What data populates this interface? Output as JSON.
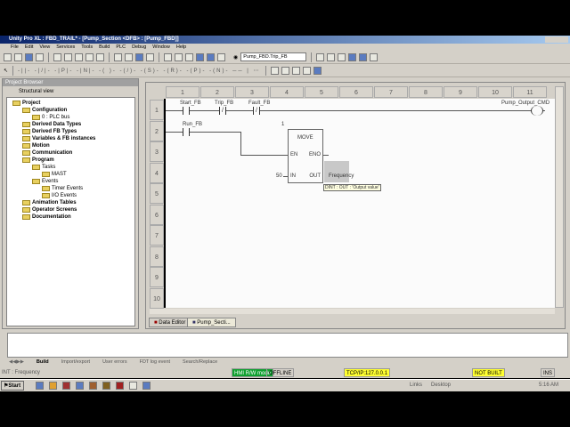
{
  "window": {
    "title": "Unity Pro XL : FBD_TRAIL* - [Pump_Section <DFB> : [Pump_FBD]]"
  },
  "menu": [
    "File",
    "Edit",
    "View",
    "Services",
    "Tools",
    "Build",
    "PLC",
    "Debug",
    "Window",
    "Help"
  ],
  "toolbar": {
    "search_value": "Pump_FBD.Trip_FB"
  },
  "browser": {
    "title": "Project Browser",
    "view": "Structural view",
    "items": [
      {
        "label": "Project",
        "bold": true,
        "indent": 0
      },
      {
        "label": "Configuration",
        "bold": true,
        "indent": 1
      },
      {
        "label": "0 : PLC bus",
        "bold": false,
        "indent": 2
      },
      {
        "label": "Derived Data Types",
        "bold": true,
        "indent": 1
      },
      {
        "label": "Derived FB Types",
        "bold": true,
        "indent": 1
      },
      {
        "label": "Variables & FB instances",
        "bold": true,
        "indent": 1
      },
      {
        "label": "Motion",
        "bold": true,
        "indent": 1
      },
      {
        "label": "Communication",
        "bold": true,
        "indent": 1
      },
      {
        "label": "Program",
        "bold": true,
        "indent": 1
      },
      {
        "label": "Tasks",
        "bold": false,
        "indent": 2
      },
      {
        "label": "MAST",
        "bold": false,
        "indent": 3
      },
      {
        "label": "Events",
        "bold": false,
        "indent": 2
      },
      {
        "label": "Timer Events",
        "bold": false,
        "indent": 3
      },
      {
        "label": "I/O Events",
        "bold": false,
        "indent": 3
      },
      {
        "label": "Animation Tables",
        "bold": true,
        "indent": 1
      },
      {
        "label": "Operator Screens",
        "bold": true,
        "indent": 1
      },
      {
        "label": "Documentation",
        "bold": true,
        "indent": 1
      }
    ]
  },
  "editor": {
    "columns": [
      "1",
      "2",
      "3",
      "4",
      "5",
      "6",
      "7",
      "8",
      "9",
      "10",
      "11"
    ],
    "rows": [
      "1",
      "2",
      "3",
      "4",
      "5",
      "6",
      "7",
      "8",
      "9",
      "10"
    ],
    "contacts": {
      "start": "Start_FB",
      "trip": "Trip_FB",
      "fault": "Fault_FB",
      "run": "Run_FB"
    },
    "coil": "Pump_Output_CMD",
    "block": {
      "number": "1",
      "name": "MOVE",
      "en": "EN",
      "eno": "ENO",
      "in": "IN",
      "out": "OUT",
      "in_value": "50",
      "out_var": "Frequency"
    },
    "tooltip": "DINT : OUT : 'Output value'",
    "tabs": [
      "Data Editor",
      "Pump_Secti..."
    ]
  },
  "output_tabs": [
    "Build",
    "Import/export",
    "User errors",
    "FDT log event",
    "Search/Replace"
  ],
  "status": {
    "left": "INT : Frequency",
    "mode": "HMI R/W mode",
    "online": "OFFLINE",
    "address": "TCP/IP:127.0.0.1",
    "build": "NOT BUILT",
    "ins": "INS"
  },
  "taskbar": {
    "start": "Start",
    "links": "Links",
    "desktop": "Desktop",
    "time": "5:16 AM"
  }
}
